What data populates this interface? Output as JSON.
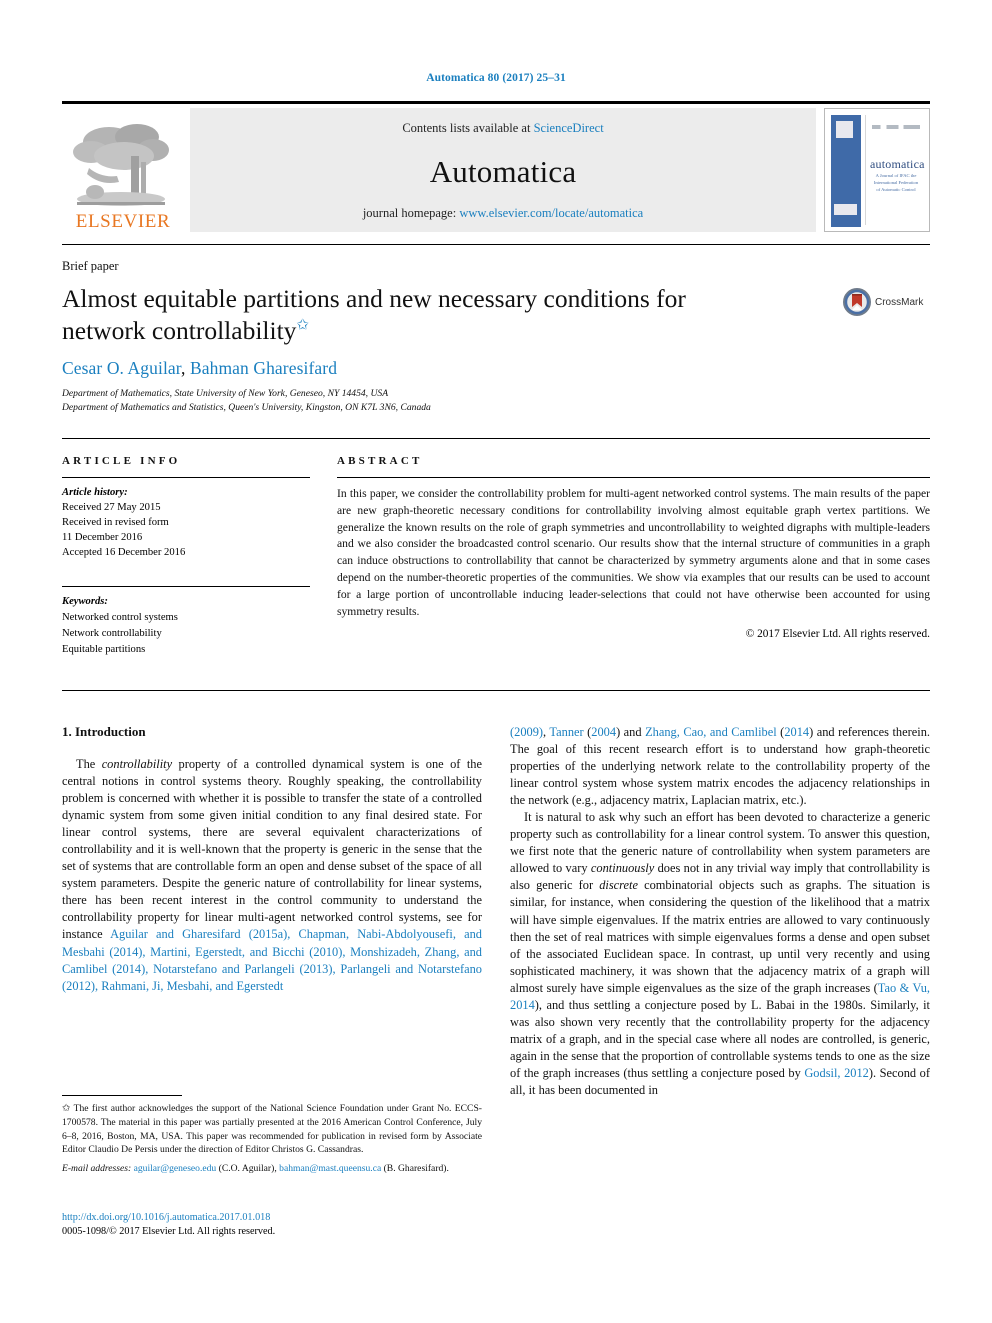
{
  "running_head": "Automatica 80 (2017) 25–31",
  "masthead": {
    "publisher_name": "ELSEVIER",
    "contents_prefix": "Contents lists available at ",
    "contents_link": "ScienceDirect",
    "journal_name": "Automatica",
    "homepage_prefix": "journal homepage: ",
    "homepage_url": "www.elsevier.com/locate/automatica",
    "cover": {
      "title": "automatica",
      "subtitle": "A Journal of IFAC the International Federation of Automatic Control"
    }
  },
  "article": {
    "type_label": "Brief paper",
    "title": "Almost equitable partitions and new necessary conditions for network controllability",
    "title_star": "✩",
    "authors": "Cesar O. Aguilar, Bahman Gharesifard",
    "author_1": "Cesar O. Aguilar",
    "author_2": "Bahman Gharesifard",
    "affiliation_1": "Department of Mathematics, State University of New York, Geneseo, NY 14454, USA",
    "affiliation_2": "Department of Mathematics and Statistics, Queen's University, Kingston, ON K7L 3N6, Canada",
    "crossmark_label": "CrossMark"
  },
  "article_info": {
    "heading": "ARTICLE INFO",
    "history_label": "Article history:",
    "history_lines": [
      "Received 27 May 2015",
      "Received in revised form",
      "11 December 2016",
      "Accepted 16 December 2016"
    ],
    "keywords_label": "Keywords:",
    "keywords": [
      "Networked control systems",
      "Network controllability",
      "Equitable partitions"
    ]
  },
  "abstract": {
    "heading": "ABSTRACT",
    "text": "In this paper, we consider the controllability problem for multi-agent networked control systems. The main results of the paper are new graph-theoretic necessary conditions for controllability involving almost equitable graph vertex partitions. We generalize the known results on the role of graph symmetries and uncontrollability to weighted digraphs with multiple-leaders and we also consider the broadcasted control scenario. Our results show that the internal structure of communities in a graph can induce obstructions to controllability that cannot be characterized by symmetry arguments alone and that in some cases depend on the number-theoretic properties of the communities. We show via examples that our results can be used to account for a large portion of uncontrollable inducing leader-selections that could not have otherwise been accounted for using symmetry results.",
    "copyright": "© 2017 Elsevier Ltd. All rights reserved."
  },
  "body": {
    "section_title": "1. Introduction",
    "left_paragraph_1_a": "The ",
    "left_paragraph_1_em": "controllability",
    "left_paragraph_1_b": " property of a controlled dynamical system is one of the central notions in control systems theory. Roughly speaking, the controllability problem is concerned with whether it is possible to transfer the state of a controlled dynamic system from some given initial condition to any final desired state. For linear control systems, there are several equivalent characterizations of controllability and it is well-known that the property is generic in the sense that the set of systems that are controllable form an open and dense subset of the space of all system parameters. Despite the generic nature of controllability for linear systems, there has been recent interest in the control community to understand the controllability property for linear multi-agent networked control systems, see for instance ",
    "left_citations": "Aguilar and Gharesifard (2015a), Chapman, Nabi-Abdolyousefi, and Mesbahi (2014), Martini, Egerstedt, and Bicchi (2010), Monshizadeh, Zhang, and Camlibel (2014), Notarstefano and Parlangeli (2013), Parlangeli and Notarstefano (2012), Rahmani, Ji, Mesbahi, and Egerstedt",
    "right_cite_1": "(2009)",
    "right_text_1": ", ",
    "right_cite_2": "Tanner",
    "right_text_2": " (",
    "right_cite_3": "2004",
    "right_text_3": ") and ",
    "right_cite_4": "Zhang, Cao, and Camlibel",
    "right_text_4": " (",
    "right_cite_5": "2014",
    "right_text_5": ") and references therein. The goal of this recent research effort is to understand how graph-theoretic properties of the underlying network relate to the controllability property of the linear control system whose system matrix encodes the adjacency relationships in the network (e.g., adjacency matrix, Laplacian matrix, etc.).",
    "right_paragraph_2_a": "It is natural to ask why such an effort has been devoted to characterize a generic property such as controllability for a linear control system. To answer this question, we first note that the generic nature of controllability when system parameters are allowed to vary ",
    "right_paragraph_2_em1": "continuously",
    "right_paragraph_2_b": " does not in any trivial way imply that controllability is also generic for ",
    "right_paragraph_2_em2": "discrete",
    "right_paragraph_2_c": " combinatorial objects such as graphs. The situation is similar, for instance, when considering the question of the likelihood that a matrix will have simple eigenvalues. If the matrix entries are allowed to vary continuously then the set of real matrices with simple eigenvalues forms a dense and open subset of the associated Euclidean space. In contrast, up until very recently and using sophisticated machinery, it was shown that the adjacency matrix of a graph will almost surely have simple eigenvalues as the size of the graph increases (",
    "right_cite_6": "Tao & Vu, 2014",
    "right_paragraph_2_d": "), and thus settling a conjecture posed by L. Babai in the 1980s. Similarly, it was also shown very recently that the controllability property for the adjacency matrix of a graph, and in the special case where all nodes are controlled, is generic, again in the sense that the proportion of controllable systems tends to one as the size of the graph increases (thus settling a conjecture posed by ",
    "right_cite_7": "Godsil, 2012",
    "right_paragraph_2_e": "). Second of all, it has been documented in"
  },
  "footnote": {
    "star": "✩",
    "text": "The first author acknowledges the support of the National Science Foundation under Grant No. ECCS-1700578. The material in this paper was partially presented at the 2016 American Control Conference, July 6–8, 2016, Boston, MA, USA. This paper was recommended for publication in revised form by Associate Editor Claudio De Persis under the direction of Editor Christos G. Cassandras.",
    "email_label": "E-mail addresses:",
    "email_1": "aguilar@geneseo.edu",
    "email_1_owner": " (C.O. Aguilar),",
    "email_2": "bahman@mast.queensu.ca",
    "email_2_owner": " (B. Gharesifard)."
  },
  "footer": {
    "doi": "http://dx.doi.org/10.1016/j.automatica.2017.01.018",
    "issn_copyright": "0005-1098/© 2017 Elsevier Ltd. All rights reserved."
  },
  "colors": {
    "link_blue": "#1a7fbf",
    "elsevier_orange": "#e87722",
    "masthead_grey": "#ececec",
    "cover_blue": "#3f6aa8",
    "crossmark_red": "#c0392b"
  }
}
